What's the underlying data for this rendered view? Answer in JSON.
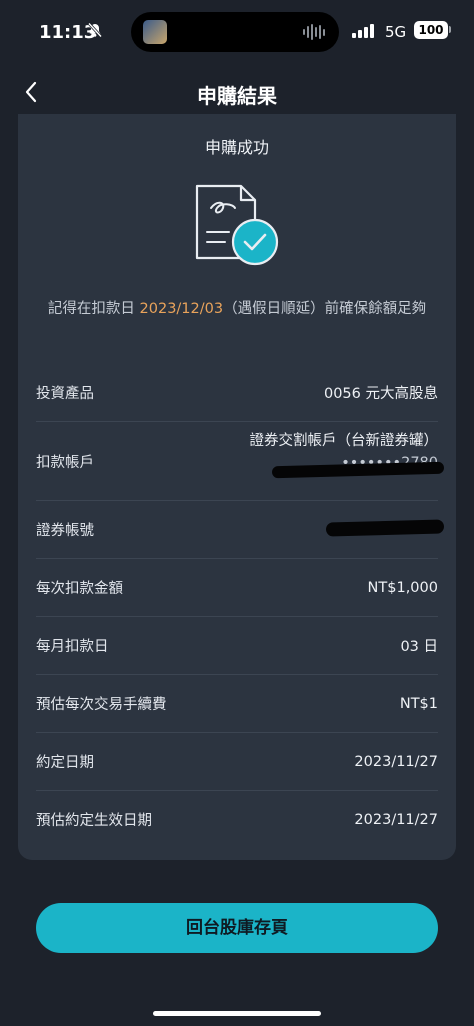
{
  "status_bar": {
    "time": "11:13",
    "network": "5G",
    "battery": "100"
  },
  "nav": {
    "title": "申購結果"
  },
  "card": {
    "title": "申購成功",
    "notice_prefix": "記得在扣款日 ",
    "notice_date": "2023/12/03",
    "notice_suffix": "（遇假日順延）前確保餘額足夠"
  },
  "rows": [
    {
      "label": "投資產品",
      "value": "0056 元大高股息"
    },
    {
      "label": "扣款帳戶",
      "value": "證券交割帳戶（台新證券罐）",
      "value2": "•••••••2780"
    },
    {
      "label": "證券帳號",
      "value": ""
    },
    {
      "label": "每次扣款金額",
      "value": "NT$1,000"
    },
    {
      "label": "每月扣款日",
      "value": "03 日"
    },
    {
      "label": "預估每次交易手續費",
      "value": "NT$1"
    },
    {
      "label": "約定日期",
      "value": "2023/11/27"
    },
    {
      "label": "預估約定生效日期",
      "value": "2023/11/27"
    }
  ],
  "button": {
    "label": "回台股庫存頁"
  },
  "colors": {
    "accent": "#1bb4c8",
    "date_highlight": "#e9a35b",
    "background": "#1d222b",
    "card": "#2c3440"
  },
  "icons": [
    "bell-slash-icon",
    "back-chevron-icon",
    "document-check-icon",
    "signal-icon",
    "battery-icon"
  ]
}
